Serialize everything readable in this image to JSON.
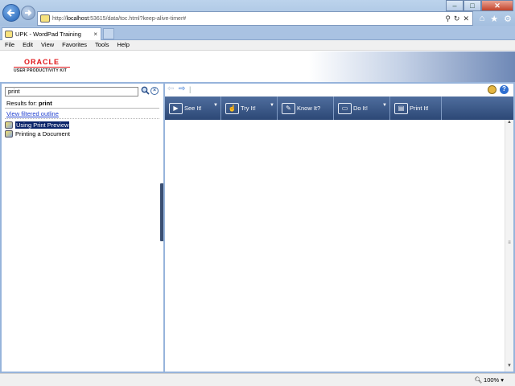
{
  "browser": {
    "address": {
      "prefix": "http://",
      "host": "localhost",
      "rest": ":53615/data/toc.html?keep-alive-timer#"
    },
    "tab_label": "UPK - WordPad Training",
    "tab_close": "×",
    "menu": [
      "File",
      "Edit",
      "View",
      "Favorites",
      "Tools",
      "Help"
    ],
    "window_controls": {
      "minimize": "–",
      "maximize": "□",
      "close": "✕"
    },
    "address_tools": {
      "search": "⚲",
      "refresh": "↻",
      "stop": "✕"
    },
    "right_tools": {
      "home": "⌂",
      "favorites": "★",
      "settings": "⚙"
    }
  },
  "header": {
    "brand": "ORACLE",
    "product": "USER PRODUCTIVITY KIT"
  },
  "left": {
    "search_value": "print",
    "results_label": "Results for:",
    "results_term": "print",
    "view_filtered": "View filtered outline",
    "topics": [
      {
        "label": "Using Print Preview",
        "selected": true
      },
      {
        "label": "Printing a Document",
        "selected": false
      }
    ]
  },
  "toolbar": {
    "modes": [
      {
        "label": "See It!",
        "icon": "▶",
        "has_dropdown": true
      },
      {
        "label": "Try It!",
        "icon": "☝",
        "has_dropdown": true
      },
      {
        "label": "Know It?",
        "icon": "✎",
        "has_dropdown": false
      },
      {
        "label": "Do It!",
        "icon": "▭",
        "has_dropdown": true
      },
      {
        "label": "Print It!",
        "icon": "▤",
        "has_dropdown": false
      }
    ],
    "help": "?"
  },
  "status": {
    "zoom": "100%"
  },
  "colors": {
    "accent": "#2c4876",
    "selection": "#0a246a",
    "brand": "#e0161a",
    "link": "#1f3fcf"
  }
}
